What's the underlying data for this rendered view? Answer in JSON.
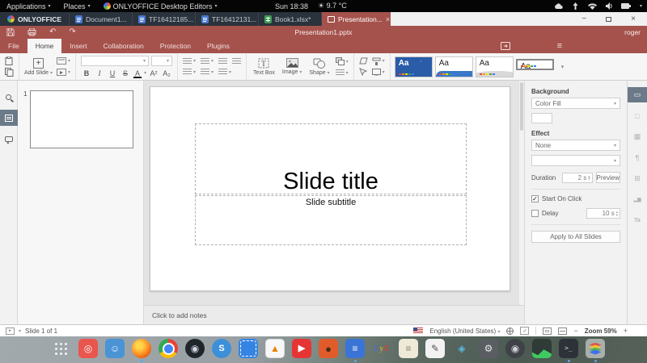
{
  "icons": {
    "caret_down": "▾",
    "caret_up": "▴",
    "caret_right": "▸",
    "undo": "↶",
    "redo": "↷",
    "minimize": "−",
    "close": "×",
    "hamburger": "≡",
    "check": "✓",
    "plus": "+",
    "sun": "☀",
    "zoom_out": "−",
    "zoom_in": "+",
    "rp_slide": "▭",
    "rp_shape": "□",
    "rp_image": "▦",
    "rp_paragraph": "¶",
    "rp_table": "⊞",
    "rp_chart": "▂▆",
    "rp_textart": "Ta",
    "spell_check": "✓"
  },
  "system_bar": {
    "applications": "Applications",
    "places": "Places",
    "app_menu": "ONLYOFFICE Desktop Editors",
    "clock": "Sun 18:38",
    "temperature": "9.7 °C"
  },
  "window": {
    "brand": "ONLYOFFICE",
    "tabs": [
      {
        "label": "Document1...",
        "type": "document"
      },
      {
        "label": "TF16412185...",
        "type": "document"
      },
      {
        "label": "TF16412131...",
        "type": "document"
      },
      {
        "label": "Book1.xlsx*",
        "type": "spreadsheet"
      },
      {
        "label": "Presentation...",
        "type": "presentation",
        "active": true
      }
    ]
  },
  "title_bar": {
    "document": "Presentation1.pptx",
    "user": "roger"
  },
  "menu": {
    "file": "File",
    "home": "Home",
    "insert": "Insert",
    "collaboration": "Collaboration",
    "protection": "Protection",
    "plugins": "Plugins",
    "active": "Home"
  },
  "toolbar": {
    "add_slide": "Add Slide",
    "font_name": "",
    "font_size": "",
    "bold": "B",
    "italic": "I",
    "underline": "U",
    "strikeout": "S",
    "font_color": "A",
    "superscript": "A²",
    "subscript": "A₂",
    "text_box": "Text Box",
    "image": "Image",
    "shape": "Shape",
    "theme_glyph": "Aa",
    "theme_names": [
      "theme-blue-dots",
      "theme-blue-stripe",
      "theme-gray-wave",
      "theme-blank-selected"
    ]
  },
  "slides_panel": {
    "slide_number": "1"
  },
  "slide": {
    "title": "Slide title",
    "subtitle": "Slide subtitle"
  },
  "notes": {
    "placeholder": "Click to add notes"
  },
  "right_panel": {
    "background_label": "Background",
    "background_fill": "Color Fill",
    "effect_label": "Effect",
    "effect_value": "None",
    "duration_label": "Duration",
    "duration_value": "2 s",
    "preview": "Preview",
    "start_on_click": "Start On Click",
    "delay_label": "Delay",
    "delay_value": "10 s",
    "apply_to_all": "Apply to All Slides"
  },
  "status_bar": {
    "slide_info": "Slide 1 of 1",
    "language": "English (United States)",
    "zoom": "Zoom 59%"
  },
  "dock": {
    "apps": [
      {
        "name": "app-grid"
      },
      {
        "name": "screenshot-tool",
        "bg": "#e8564e",
        "glyph": "◎",
        "fg": "#ffffff"
      },
      {
        "name": "file-manager",
        "bg": "#4a93d5",
        "glyph": "☺",
        "fg": "#eaf3fb"
      },
      {
        "name": "firefox",
        "running": true
      },
      {
        "name": "chrome"
      },
      {
        "name": "steam",
        "bg": "#20242b",
        "shape": "circle",
        "glyph": "◉",
        "fg": "#cfd6de"
      },
      {
        "name": "skype",
        "bg": "#3c8fd9",
        "shape": "circle",
        "glyph": "S",
        "fg": "#ffffff"
      },
      {
        "name": "mail-stamp",
        "bg": "#3584e4"
      },
      {
        "name": "vlc",
        "bg": "#f7f7f7",
        "glyph": "▲",
        "fg": "#ef7d00"
      },
      {
        "name": "youtube",
        "bg": "#e63434",
        "glyph": "▶",
        "fg": "#ffffff"
      },
      {
        "name": "gimp",
        "bg": "#e25b2a",
        "glyph": "●",
        "fg": "#4a2c1a"
      },
      {
        "name": "document-editor",
        "bg": "#3a74d6",
        "glyph": "≡",
        "fg": "#ffffff",
        "running": true
      },
      {
        "name": "lyx",
        "glyph": "LyX"
      },
      {
        "name": "notes-app",
        "bg": "#efe9d8",
        "glyph": "≡",
        "fg": "#8a8472"
      },
      {
        "name": "text-editor",
        "bg": "#f2f2f2",
        "glyph": "✎",
        "fg": "#555555"
      },
      {
        "name": "cube-app",
        "glyph": "◈",
        "fg": "#56bde8"
      },
      {
        "name": "settings",
        "bg": "#5a5d61",
        "glyph": "⚙",
        "fg": "#e8e8e8"
      },
      {
        "name": "media-player",
        "bg": "#3f4247",
        "shape": "circle",
        "glyph": "◉",
        "fg": "#d0d4d8"
      },
      {
        "name": "system-monitor",
        "bg": "#2f3b36"
      },
      {
        "name": "terminal",
        "bg": "#2d3138",
        "glyph": ">_",
        "fg": "#cdd3da",
        "running": true
      },
      {
        "name": "onlyoffice-desktop",
        "running": true
      }
    ]
  }
}
